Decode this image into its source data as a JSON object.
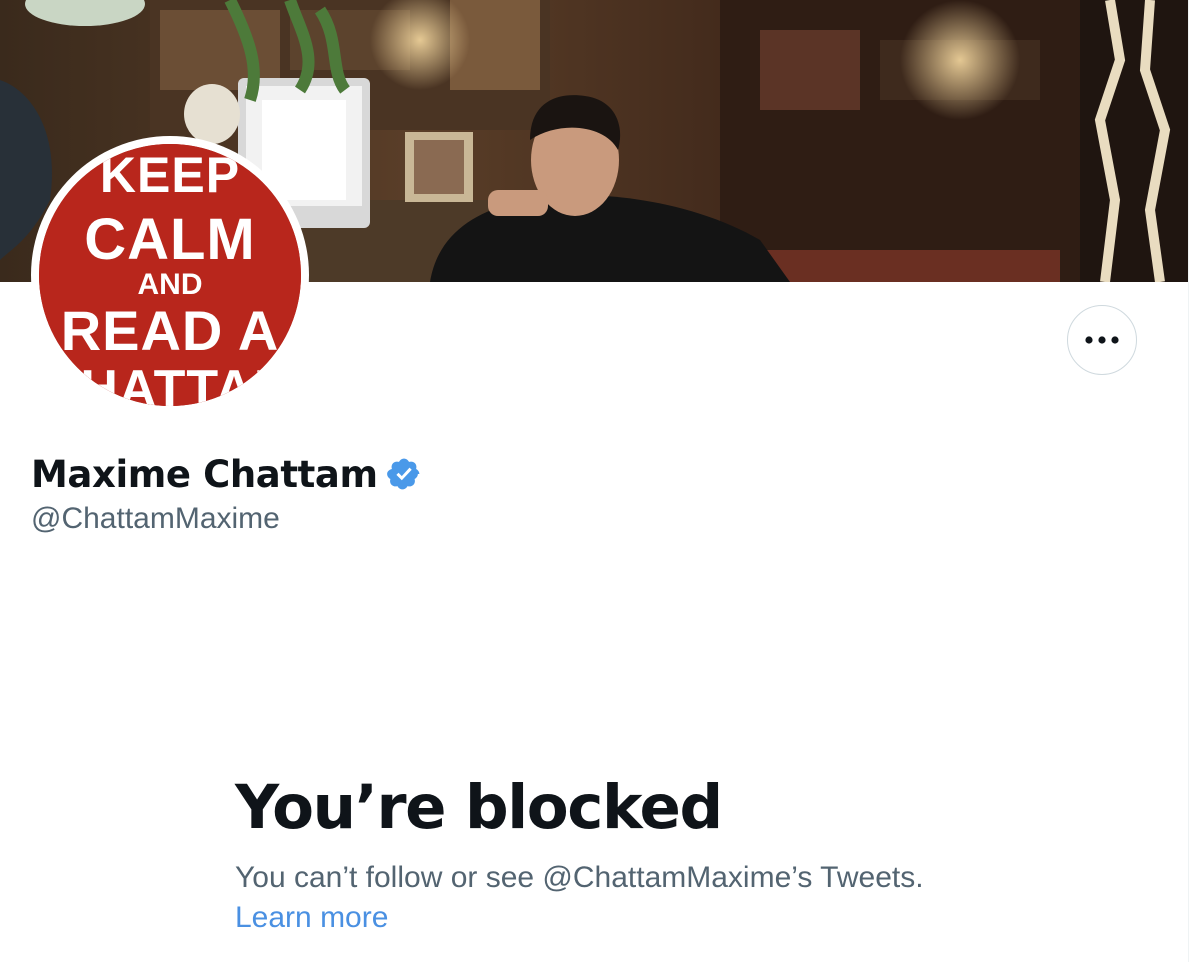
{
  "profile": {
    "display_name": "Maxime Chattam",
    "handle": "@ChattamMaxime",
    "verified": true,
    "verified_color": "#4a99e9",
    "avatar": {
      "description_text_lines": [
        "KEEP",
        "CALM",
        "AND",
        "READ A",
        "CHATTAM"
      ],
      "color": "#b8261c"
    },
    "banner_icon": "profile-banner-photo"
  },
  "actions": {
    "more_icon": "more-horizontal-icon",
    "more_label": "More"
  },
  "blocked": {
    "title": "You’re blocked",
    "message": "You can’t follow or see @ChattamMaxime’s Tweets.",
    "learn_more": "Learn more",
    "link_color": "#4a90e2"
  }
}
